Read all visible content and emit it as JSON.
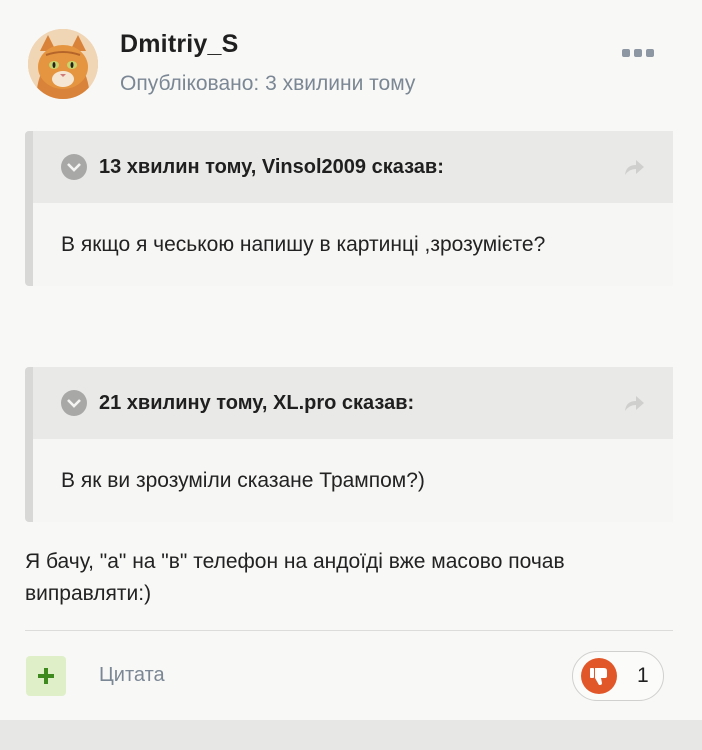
{
  "post": {
    "author": "Dmitriy_S",
    "published": "Опубліковано: 3 хвилини тому",
    "avatar_icon": "cat-avatar",
    "menu_icon": "more-options-icon"
  },
  "quotes": [
    {
      "cite": "13 хвилин тому, Vinsol2009 сказав:",
      "text": "В якщо я чеською напишу в картинці ,зрозумієте?"
    },
    {
      "cite": "21 хвилину тому, XL.pro сказав:",
      "text": "В як ви зрозуміли сказане Трампом?)"
    }
  ],
  "body": {
    "text": "Я бачу, \"а\" на \"в\" телефон на андоїді вже масово почав виправляти:)"
  },
  "footer": {
    "quote_label": "Цитата",
    "reaction_count": "1",
    "reaction_icon": "thumbs-down-icon",
    "plus_icon": "plus-icon"
  },
  "colors": {
    "reaction": "#e2572a",
    "plus_bg": "#dff0c8",
    "plus_fg": "#3f8a1f",
    "meta": "#7b8795"
  }
}
